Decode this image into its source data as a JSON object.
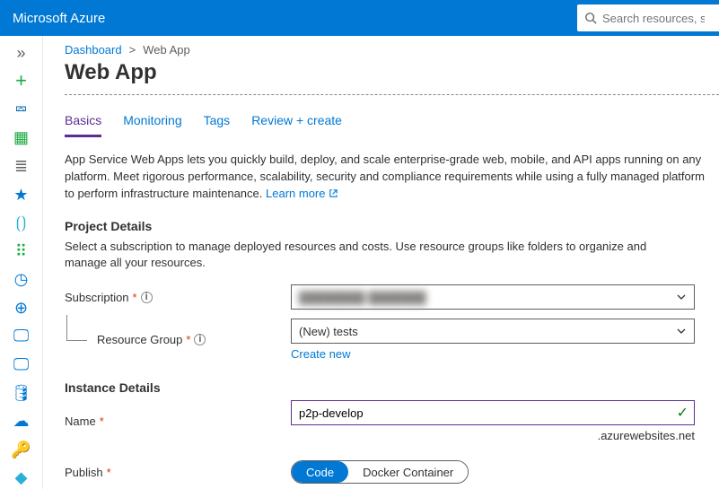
{
  "topbar": {
    "brand": "Microsoft Azure",
    "search_placeholder": "Search resources, services"
  },
  "sidebar": {
    "items": [
      {
        "name": "chevron-expand-icon",
        "glyph": "»",
        "color": "#605e5c"
      },
      {
        "name": "plus-icon",
        "glyph": "+",
        "color": "#1aab40",
        "size": "22",
        "weight": "300"
      },
      {
        "name": "home-icon",
        "glyph": "⮹",
        "color": "#0062ad"
      },
      {
        "name": "dashboard-icon",
        "glyph": "▦",
        "color": "#1aab40"
      },
      {
        "name": "list-icon",
        "glyph": "≣",
        "color": "#605e5c"
      },
      {
        "name": "favorite-icon",
        "glyph": "★",
        "color": "#0078d4"
      },
      {
        "name": "resources-icon",
        "glyph": "⟮⟯",
        "color": "#29b0d6"
      },
      {
        "name": "apps-grid-icon",
        "glyph": "⠿",
        "color": "#1aab40"
      },
      {
        "name": "clock-icon",
        "glyph": "◷",
        "color": "#0078d4"
      },
      {
        "name": "globe-icon",
        "glyph": "⊕",
        "color": "#0078d4"
      },
      {
        "name": "monitor-icon",
        "glyph": "🖵",
        "color": "#0078d4"
      },
      {
        "name": "vm-icon",
        "glyph": "🖵",
        "color": "#0078d4"
      },
      {
        "name": "sql-icon",
        "glyph": "🛢",
        "color": "#0078d4"
      },
      {
        "name": "cloud-icon",
        "glyph": "☁",
        "color": "#0078d4"
      },
      {
        "name": "key-icon",
        "glyph": "🔑",
        "color": "#ffb900"
      },
      {
        "name": "diamond-icon",
        "glyph": "◆",
        "color": "#29b0d6"
      }
    ]
  },
  "breadcrumbs": {
    "root": "Dashboard",
    "current": "Web App"
  },
  "page": {
    "title": "Web App"
  },
  "tabs": [
    {
      "label": "Basics",
      "active": true
    },
    {
      "label": "Monitoring",
      "active": false
    },
    {
      "label": "Tags",
      "active": false
    },
    {
      "label": "Review + create",
      "active": false
    }
  ],
  "description": {
    "text": "App Service Web Apps lets you quickly build, deploy, and scale enterprise-grade web, mobile, and API apps running on any platform. Meet rigorous performance, scalability, security and compliance requirements while using a fully managed platform to perform infrastructure maintenance.",
    "learn_more": "Learn more"
  },
  "project_details": {
    "heading": "Project Details",
    "desc": "Select a subscription to manage deployed resources and costs. Use resource groups like folders to organize and manage all your resources.",
    "subscription_label": "Subscription",
    "subscription_value_masked": "████████  ███████",
    "resource_group_label": "Resource Group",
    "resource_group_value": "(New) tests",
    "create_new": "Create new"
  },
  "instance_details": {
    "heading": "Instance Details",
    "name_label": "Name",
    "name_value": "p2p-develop",
    "name_suffix": ".azurewebsites.net",
    "publish_label": "Publish",
    "publish_options": [
      {
        "label": "Code",
        "active": true
      },
      {
        "label": "Docker Container",
        "active": false
      }
    ]
  }
}
